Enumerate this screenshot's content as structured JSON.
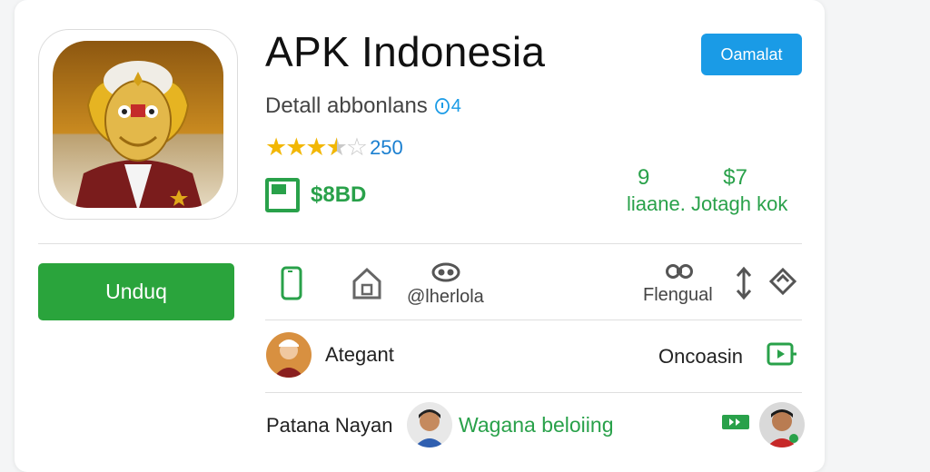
{
  "app": {
    "title": "APK Indonesia",
    "subtitle": "Detall abbonlans",
    "subtitle_badge": "4",
    "rating_count": "250",
    "rating": 3.5,
    "price": "$8BD"
  },
  "top_button": {
    "label": "Oamalat"
  },
  "stats": {
    "value_1": "9",
    "value_2": "$7",
    "label": "liaane. Jotagh  kok"
  },
  "download_button": {
    "label": "Unduq"
  },
  "toolbar": {
    "item_3_label": "@lherlola",
    "item_4_label": "Flengual"
  },
  "rows": [
    {
      "name": "Ategant",
      "right_label": "Oncoasin"
    },
    {
      "name": "Patana Nayan",
      "middle_label": "Wagana beloiing"
    }
  ],
  "colors": {
    "accent_blue": "#1a9be6",
    "accent_green": "#2aa43c",
    "star_gold": "#f2b705"
  },
  "icons": [
    "app-logo-icon",
    "phone-icon",
    "home-icon",
    "link-icon",
    "binoculars-icon",
    "sort-icon",
    "tag-icon",
    "video-icon",
    "forward-icon"
  ]
}
